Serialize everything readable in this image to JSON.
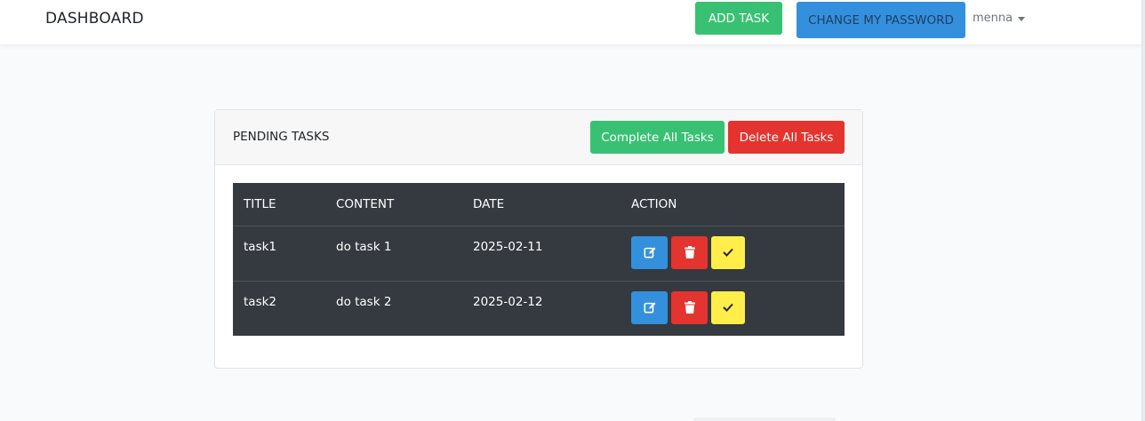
{
  "navbar": {
    "brand": "DASHBOARD",
    "add_task_label": "ADD TASK",
    "change_password_label": "CHANGE MY PASSWORD",
    "user_name": "menna"
  },
  "card": {
    "title": "PENDING TASKS",
    "complete_all_label": "Complete All Tasks",
    "delete_all_label": "Delete All Tasks"
  },
  "table": {
    "headers": [
      "TITLE",
      "CONTENT",
      "DATE",
      "ACTION"
    ],
    "rows": [
      {
        "title": "task1",
        "content": "do task 1",
        "date": "2025-02-11"
      },
      {
        "title": "task2",
        "content": "do task 2",
        "date": "2025-02-12"
      }
    ]
  },
  "colors": {
    "success": "#38c172",
    "primary": "#3490dc",
    "danger": "#e3342f",
    "warning": "#ffed4a",
    "table_dark": "#343a40"
  },
  "icons": {
    "edit": "edit-icon",
    "delete": "trash-icon",
    "complete": "check-icon"
  }
}
